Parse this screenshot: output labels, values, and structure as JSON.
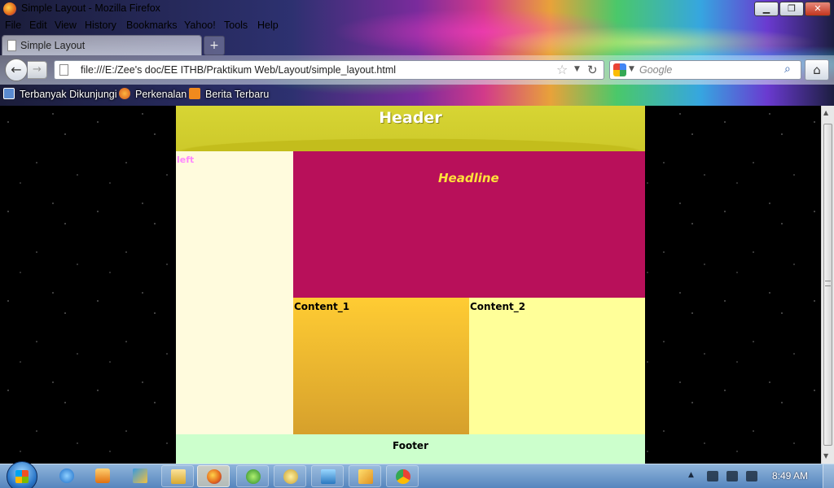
{
  "window": {
    "title": "Simple Layout - Mozilla Firefox",
    "controls": {
      "minimize": "▁",
      "maximize": "❐",
      "close": "✕"
    }
  },
  "menu": [
    "File",
    "Edit",
    "View",
    "History",
    "Bookmarks",
    "Yahoo!",
    "Tools",
    "Help"
  ],
  "tab": {
    "label": "Simple Layout",
    "new_tab_glyph": "+"
  },
  "nav": {
    "back_glyph": "←",
    "forward_glyph": "→",
    "url": "file:///E:/Zee's doc/EE ITHB/Praktikum Web/Layout/simple_layout.html",
    "star_glyph": "☆",
    "dropdown_glyph": "▼",
    "reload_glyph": "↻",
    "search_placeholder": "Google",
    "search_glyph": "⌕",
    "home_glyph": "⌂"
  },
  "bookmarks": [
    {
      "label": "Terbanyak Dikunjungi",
      "icon": "magnifier-icon"
    },
    {
      "label": "Perkenalan",
      "icon": "firefox-icon"
    },
    {
      "label": "Berita Terbaru",
      "icon": "rss-icon"
    }
  ],
  "page": {
    "header": "Header",
    "left": "left",
    "headline": "Headline",
    "content_1": "Content_1",
    "content_2": "Content_2",
    "footer": "Footer"
  },
  "scrollbar": {
    "up_glyph": "▲",
    "down_glyph": "▼"
  },
  "taskbar": {
    "tray_arrow": "▲",
    "clock": "8:49 AM"
  },
  "colors": {
    "header": "#cdc92a",
    "left": "#fffbdd",
    "headline_bg": "#b8105a",
    "headline_text": "#ffe23a",
    "content_1": "#ffcc33",
    "content_2": "#ffff99",
    "footer": "#ccffcc",
    "left_label": "#ff88ff"
  }
}
